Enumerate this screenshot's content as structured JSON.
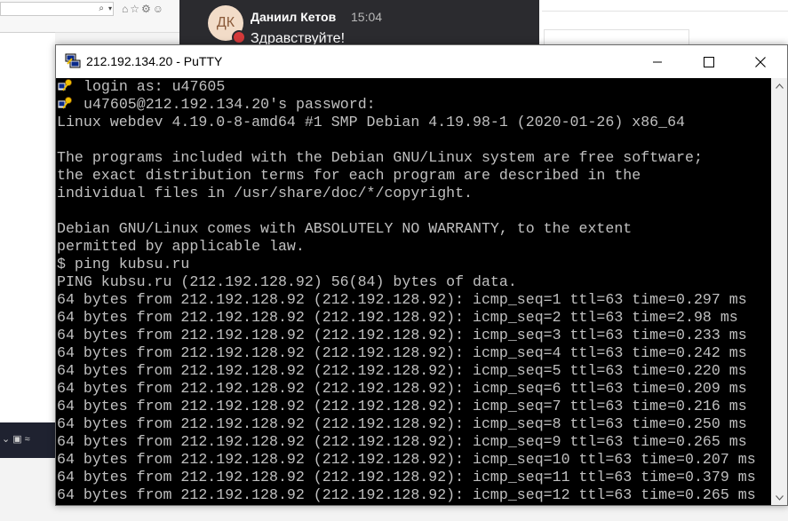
{
  "messenger": {
    "avatar_initials": "ДК",
    "sender": "Даниил Кетов",
    "time": "15:04",
    "message": "Здравствуйте!"
  },
  "window": {
    "title": "212.192.134.20 - PuTTY",
    "icons": {
      "app": "putty-icon",
      "minimize": "minimize-icon",
      "maximize": "maximize-icon",
      "close": "close-icon"
    }
  },
  "terminal": {
    "lines": [
      "login as: u47605",
      "u47605@212.192.134.20's password:",
      "Linux webdev 4.19.0-8-amd64 #1 SMP Debian 4.19.98-1 (2020-01-26) x86_64",
      "",
      "The programs included with the Debian GNU/Linux system are free software;",
      "the exact distribution terms for each program are described in the",
      "individual files in /usr/share/doc/*/copyright.",
      "",
      "Debian GNU/Linux comes with ABSOLUTELY NO WARRANTY, to the extent",
      "permitted by applicable law.",
      "$ ping kubsu.ru",
      "PING kubsu.ru (212.192.128.92) 56(84) bytes of data.",
      "64 bytes from 212.192.128.92 (212.192.128.92): icmp_seq=1 ttl=63 time=0.297 ms",
      "64 bytes from 212.192.128.92 (212.192.128.92): icmp_seq=2 ttl=63 time=2.98 ms",
      "64 bytes from 212.192.128.92 (212.192.128.92): icmp_seq=3 ttl=63 time=0.233 ms",
      "64 bytes from 212.192.128.92 (212.192.128.92): icmp_seq=4 ttl=63 time=0.242 ms",
      "64 bytes from 212.192.128.92 (212.192.128.92): icmp_seq=5 ttl=63 time=0.220 ms",
      "64 bytes from 212.192.128.92 (212.192.128.92): icmp_seq=6 ttl=63 time=0.209 ms",
      "64 bytes from 212.192.128.92 (212.192.128.92): icmp_seq=7 ttl=63 time=0.216 ms",
      "64 bytes from 212.192.128.92 (212.192.128.92): icmp_seq=8 ttl=63 time=0.250 ms",
      "64 bytes from 212.192.128.92 (212.192.128.92): icmp_seq=9 ttl=63 time=0.265 ms",
      "64 bytes from 212.192.128.92 (212.192.128.92): icmp_seq=10 ttl=63 time=0.207 ms",
      "64 bytes from 212.192.128.92 (212.192.128.92): icmp_seq=11 ttl=63 time=0.379 ms",
      "64 bytes from 212.192.128.92 (212.192.128.92): icmp_seq=12 ttl=63 time=0.265 ms"
    ],
    "key_icon_lines": [
      0,
      1
    ],
    "colors": {
      "background": "#000000",
      "foreground": "#c0c0c0"
    }
  }
}
